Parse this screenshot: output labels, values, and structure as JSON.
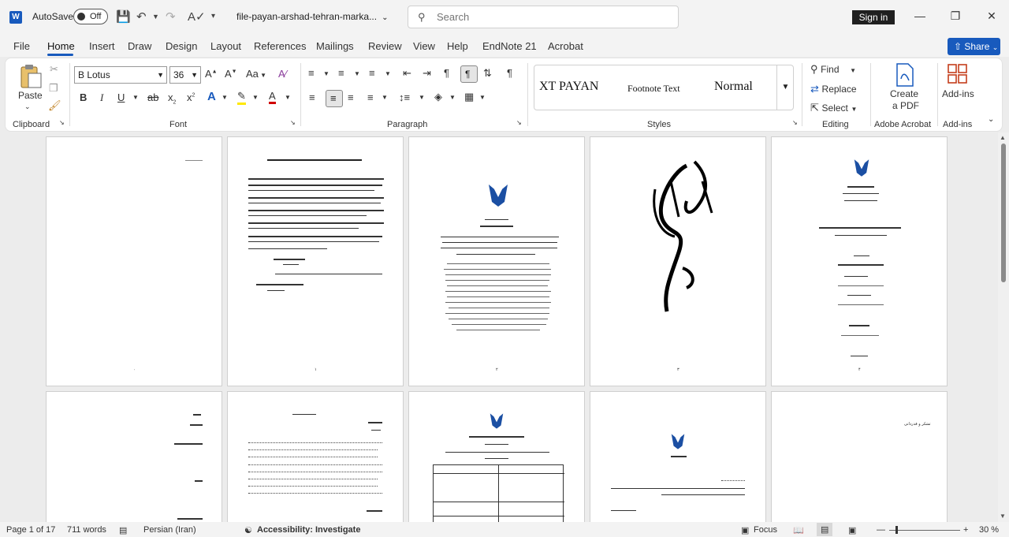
{
  "titlebar": {
    "autosave_label": "AutoSave",
    "autosave_state": "Off",
    "filename": "file-payan-arshad-tehran-marka...",
    "search_placeholder": "Search",
    "signin_label": "Sign in"
  },
  "tabs": [
    {
      "label": "File"
    },
    {
      "label": "Home"
    },
    {
      "label": "Insert"
    },
    {
      "label": "Draw"
    },
    {
      "label": "Design"
    },
    {
      "label": "Layout"
    },
    {
      "label": "References"
    },
    {
      "label": "Mailings"
    },
    {
      "label": "Review"
    },
    {
      "label": "View"
    },
    {
      "label": "Help"
    },
    {
      "label": "EndNote 21"
    },
    {
      "label": "Acrobat"
    }
  ],
  "share_label": "Share",
  "ribbon": {
    "paste_label": "Paste",
    "clipboard_label": "Clipboard",
    "font_name": "B Lotus",
    "font_size": "36",
    "font_label": "Font",
    "paragraph_label": "Paragraph",
    "styles": [
      "XT PAYAN",
      "Footnote Text",
      "Normal"
    ],
    "styles_label": "Styles",
    "find_label": "Find",
    "replace_label": "Replace",
    "select_label": "Select",
    "editing_label": "Editing",
    "create_pdf_line1": "Create",
    "create_pdf_line2": "a PDF",
    "adobe_label": "Adobe Acrobat",
    "addins_button": "Add-ins",
    "addins_label": "Add-ins"
  },
  "statusbar": {
    "page": "Page 1 of 17",
    "words": "711 words",
    "language": "Persian (Iran)",
    "accessibility": "Accessibility: Investigate",
    "focus": "Focus",
    "zoom": "30 %"
  },
  "pages": {
    "p10_heading": "تشکر و قدردانی"
  }
}
